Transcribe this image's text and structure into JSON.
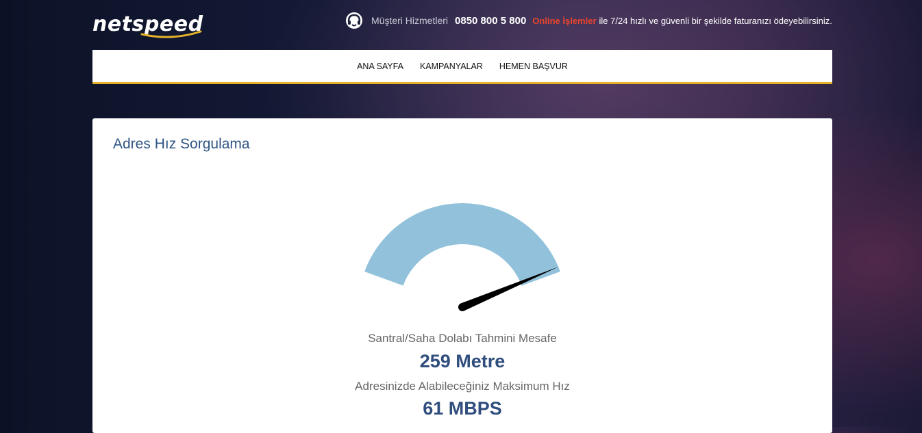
{
  "header": {
    "logo_text": "netspeed",
    "service_label": "Müşteri Hizmetleri",
    "phone": "0850 800 5 800",
    "online_link": "Online İşlemler",
    "message": "ile 7/24 hızlı ve güvenli bir şekilde faturanızı ödeyebilirsiniz.",
    "icons": [
      "headset-icon"
    ]
  },
  "nav": {
    "items": [
      {
        "label": "ANA SAYFA"
      },
      {
        "label": "KAMPANYALAR"
      },
      {
        "label": "HEMEN BAŞVUR"
      }
    ]
  },
  "card": {
    "title": "Adres Hız Sorgulama",
    "distance_label": "Santral/Saha Dolabı Tahmini Mesafe",
    "distance_value": "259 Metre",
    "speed_label": "Adresinizde Alabileceğiniz Maksimum Hız",
    "speed_value": "61 MBPS"
  },
  "gauge": {
    "level": 0.98,
    "color": "#92c1db",
    "needle_color": "#000000"
  },
  "colors": {
    "accent": "#e4b12a",
    "title": "#2f5585",
    "online": "#e8442c"
  }
}
